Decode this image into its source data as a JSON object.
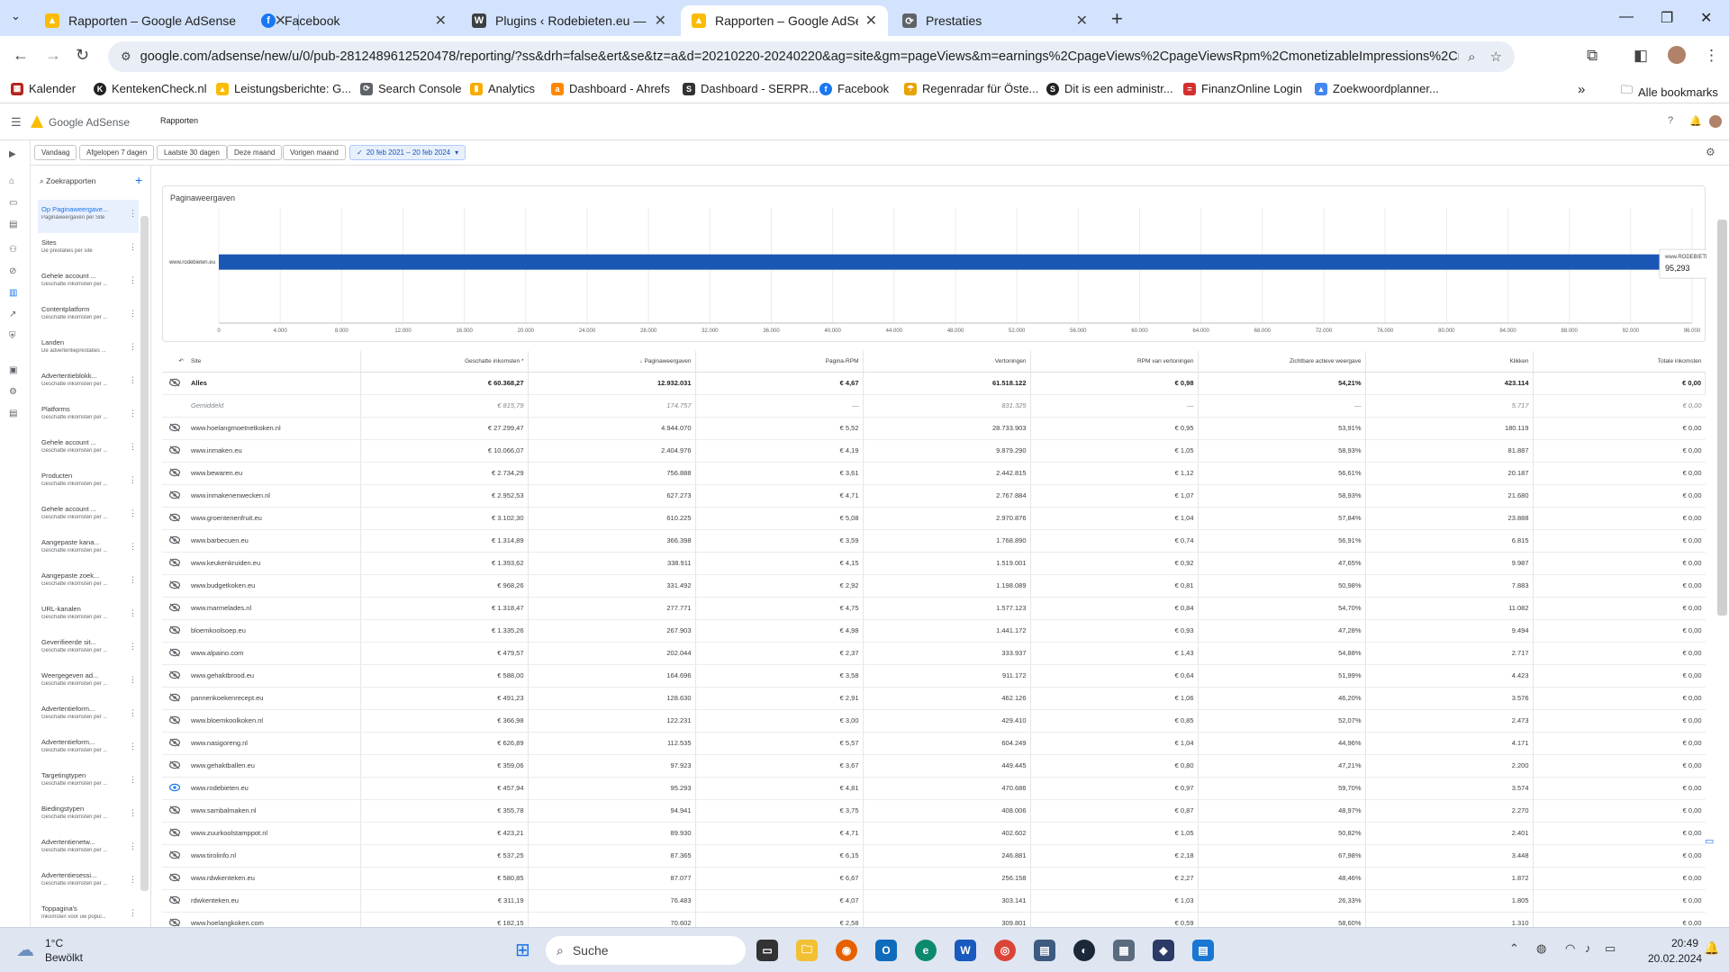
{
  "browser": {
    "tabs": [
      {
        "title": "Rapporten – Google AdSense",
        "icon": "adsense-icon",
        "active": false
      },
      {
        "title": "Facebook",
        "icon": "facebook-icon",
        "active": false
      },
      {
        "title": "Plugins ‹ Rodebieten.eu — Wor",
        "icon": "wordpress-icon",
        "active": false
      },
      {
        "title": "Rapporten – Google AdSense",
        "icon": "adsense-icon",
        "active": true
      },
      {
        "title": "Prestaties",
        "icon": "search-console-icon",
        "active": false
      }
    ],
    "url": "google.com/adsense/new/u/0/pub-2812489612520478/reporting/?ss&drh=false&ert&se&tz=a&d=20210220-20240220&ag=site&gm=pageViews&m=earnings%2CpageViews%2CpageViewsRpm%2CmonetizableImpressions%2Cmonetizabl...",
    "bookmarks": [
      "Kalender",
      "KentekenCheck.nl",
      "Leistungsberichte: G...",
      "Search Console",
      "Analytics",
      "Dashboard - Ahrefs",
      "Dashboard - SERPR...",
      "Facebook",
      "Regenradar für Öste...",
      "Dit is een administr...",
      "FinanzOnline Login",
      "Zoekwoordplanner..."
    ],
    "all_bookmarks": "Alle bookmarks"
  },
  "app": {
    "name": "Google AdSense",
    "section": "Rapporten"
  },
  "filters": [
    "Vandaag",
    "Afgelopen 7 dagen",
    "Laatste 30 dagen",
    "Deze maand",
    "Vorigen maand",
    "20 feb 2021 – 20 feb 2024"
  ],
  "reports": {
    "search_label": "Zoekrapporten",
    "items": [
      {
        "title": "Op Paginaweergave...",
        "subtitle": "Paginaweergaven per Site",
        "active": true
      },
      {
        "title": "Sites",
        "subtitle": "De prestaties per site"
      },
      {
        "title": "Gehele account ...",
        "subtitle": "Geschatte inkomsten per ..."
      },
      {
        "title": "Contentplatform",
        "subtitle": "Geschatte inkomsten per ..."
      },
      {
        "title": "Landen",
        "subtitle": "De advertentieprestaties ..."
      },
      {
        "title": "Advertentieblokk...",
        "subtitle": "Geschatte inkomsten per ..."
      },
      {
        "title": "Platforms",
        "subtitle": "Geschatte inkomsten per ..."
      },
      {
        "title": "Gehele account ...",
        "subtitle": "Geschatte inkomsten per ..."
      },
      {
        "title": "Producten",
        "subtitle": "Geschatte inkomsten per ..."
      },
      {
        "title": "Gehele account ...",
        "subtitle": "Geschatte inkomsten per ..."
      },
      {
        "title": "Aangepaste kana...",
        "subtitle": "Geschatte inkomsten per ..."
      },
      {
        "title": "Aangepaste zoek...",
        "subtitle": "Geschatte inkomsten per ..."
      },
      {
        "title": "URL-kanalen",
        "subtitle": "Geschatte inkomsten per ..."
      },
      {
        "title": "Geverifieerde sit...",
        "subtitle": "Geschatte inkomsten per ..."
      },
      {
        "title": "Weergegeven ad...",
        "subtitle": "Geschatte inkomsten per ..."
      },
      {
        "title": "Advertentieform...",
        "subtitle": "Geschatte inkomsten per ..."
      },
      {
        "title": "Advertentieform...",
        "subtitle": "Geschatte inkomsten per ..."
      },
      {
        "title": "Targetingtypen",
        "subtitle": "Geschatte inkomsten per ..."
      },
      {
        "title": "Biedingstypen",
        "subtitle": "Geschatte inkomsten per ..."
      },
      {
        "title": "Advertentienetw...",
        "subtitle": "Geschatte inkomsten per ..."
      },
      {
        "title": "Advertentiesessi...",
        "subtitle": "Geschatte inkomsten per ..."
      },
      {
        "title": "Toppagina's",
        "subtitle": "Inkomsten voor uw popul..."
      }
    ]
  },
  "chart_data": {
    "type": "bar",
    "title": "Paginaweergaven",
    "categories": [
      "www.rodebieten.eu"
    ],
    "values": [
      95293
    ],
    "xlim": [
      0,
      96000
    ],
    "xticks": [
      "0",
      "4.000",
      "8.000",
      "12.000",
      "16.000",
      "20.000",
      "24.000",
      "28.000",
      "32.000",
      "36.000",
      "40.000",
      "44.000",
      "48.000",
      "52.000",
      "56.000",
      "60.000",
      "64.000",
      "68.000",
      "72.000",
      "76.000",
      "80.000",
      "84.000",
      "88.000",
      "92.000",
      "96.000"
    ],
    "tooltip": {
      "label": "www.RODEBIETEN.eu",
      "value": "95,293"
    },
    "bar_color": "#1a56b4"
  },
  "table": {
    "columns": [
      "Site",
      "Geschatte inkomsten",
      "Paginaweergaven",
      "Pagina-RPM",
      "Vertoningen",
      "RPM van vertoningen",
      "Zichtbare actieve weergave",
      "Klikken",
      "Totale inkomsten"
    ],
    "rows": [
      {
        "site": "Alles",
        "cells": [
          "€ 60.368,27",
          "12.932.031",
          "€ 4,67",
          "61.518.122",
          "€ 0,98",
          "54,21%",
          "423.114",
          "€ 0,00"
        ],
        "bold": true
      },
      {
        "site": "Gemiddeld",
        "cells": [
          "€ 815,79",
          "174.757",
          "—",
          "831.325",
          "—",
          "—",
          "5.717",
          "€ 0,00"
        ],
        "avg": true
      },
      {
        "site": "www.hoelangmoetnetkoken.nl",
        "cells": [
          "€ 27.299,47",
          "4.944.070",
          "€ 5,52",
          "28.733.903",
          "€ 0,95",
          "53,91%",
          "180.119",
          "€ 0,00"
        ]
      },
      {
        "site": "www.inmaken.eu",
        "cells": [
          "€ 10.066,07",
          "2.404.976",
          "€ 4,19",
          "9.879.290",
          "€ 1,05",
          "58,93%",
          "81.887",
          "€ 0,00"
        ]
      },
      {
        "site": "www.bewaren.eu",
        "cells": [
          "€ 2.734,29",
          "756.888",
          "€ 3,61",
          "2.442.815",
          "€ 1,12",
          "56,61%",
          "20.187",
          "€ 0,00"
        ]
      },
      {
        "site": "www.inmakenenwecken.nl",
        "cells": [
          "€ 2.952,53",
          "627.273",
          "€ 4,71",
          "2.767.884",
          "€ 1,07",
          "58,93%",
          "21.680",
          "€ 0,00"
        ]
      },
      {
        "site": "www.groentenenfruit.eu",
        "cells": [
          "€ 3.102,30",
          "610.225",
          "€ 5,08",
          "2.970.876",
          "€ 1,04",
          "57,84%",
          "23.888",
          "€ 0,00"
        ]
      },
      {
        "site": "www.barbecuen.eu",
        "cells": [
          "€ 1.314,89",
          "366.398",
          "€ 3,59",
          "1.768.890",
          "€ 0,74",
          "56,91%",
          "6.815",
          "€ 0,00"
        ]
      },
      {
        "site": "www.keukenkruiden.eu",
        "cells": [
          "€ 1.393,62",
          "338.911",
          "€ 4,15",
          "1.519.001",
          "€ 0,92",
          "47,65%",
          "9.987",
          "€ 0,00"
        ]
      },
      {
        "site": "www.budgetkoken.eu",
        "cells": [
          "€ 968,26",
          "331.492",
          "€ 2,92",
          "1.198.089",
          "€ 0,81",
          "50,98%",
          "7.883",
          "€ 0,00"
        ]
      },
      {
        "site": "www.marmelades.nl",
        "cells": [
          "€ 1.318,47",
          "277.771",
          "€ 4,75",
          "1.577.123",
          "€ 0,84",
          "54,70%",
          "11.082",
          "€ 0,00"
        ]
      },
      {
        "site": "bloemkoolsoep.eu",
        "cells": [
          "€ 1.335,26",
          "267.903",
          "€ 4,98",
          "1.441.172",
          "€ 0,93",
          "47,28%",
          "9.494",
          "€ 0,00"
        ]
      },
      {
        "site": "www.alpaino.com",
        "cells": [
          "€ 479,57",
          "202.044",
          "€ 2,37",
          "333.937",
          "€ 1,43",
          "54,88%",
          "2.717",
          "€ 0,00"
        ]
      },
      {
        "site": "www.gehaktbrood.eu",
        "cells": [
          "€ 588,00",
          "164.696",
          "€ 3,58",
          "911.172",
          "€ 0,64",
          "51,99%",
          "4.423",
          "€ 0,00"
        ]
      },
      {
        "site": "pannenkoekenrecept.eu",
        "cells": [
          "€ 491,23",
          "128.630",
          "€ 2,91",
          "462.126",
          "€ 1,06",
          "46,20%",
          "3.576",
          "€ 0,00"
        ]
      },
      {
        "site": "www.bloemkoolkoken.nl",
        "cells": [
          "€ 366,98",
          "122.231",
          "€ 3,00",
          "429.410",
          "€ 0,85",
          "52,07%",
          "2.473",
          "€ 0,00"
        ]
      },
      {
        "site": "www.nasigoreng.nl",
        "cells": [
          "€ 626,89",
          "112.535",
          "€ 5,57",
          "604.249",
          "€ 1,04",
          "44,96%",
          "4.171",
          "€ 0,00"
        ]
      },
      {
        "site": "www.gehaktballen.eu",
        "cells": [
          "€ 359,06",
          "97.923",
          "€ 3,67",
          "449.445",
          "€ 0,80",
          "47,21%",
          "2.200",
          "€ 0,00"
        ]
      },
      {
        "site": "www.rodebieten.eu",
        "cells": [
          "€ 457,94",
          "95.293",
          "€ 4,81",
          "470.686",
          "€ 0,97",
          "59,70%",
          "3.574",
          "€ 0,00"
        ],
        "visible": true
      },
      {
        "site": "www.sambalmaken.nl",
        "cells": [
          "€ 355,78",
          "94.941",
          "€ 3,75",
          "408.006",
          "€ 0,87",
          "48,97%",
          "2.270",
          "€ 0,00"
        ]
      },
      {
        "site": "www.zuurkoolstamppot.nl",
        "cells": [
          "€ 423,21",
          "89.930",
          "€ 4,71",
          "402.602",
          "€ 1,05",
          "50,82%",
          "2.401",
          "€ 0,00"
        ]
      },
      {
        "site": "www.tirolinfo.nl",
        "cells": [
          "€ 537,25",
          "87.365",
          "€ 6,15",
          "246.881",
          "€ 2,18",
          "67,98%",
          "3.448",
          "€ 0,00"
        ]
      },
      {
        "site": "www.rdwkenteken.eu",
        "cells": [
          "€ 580,85",
          "87.077",
          "€ 6,67",
          "256.158",
          "€ 2,27",
          "48,46%",
          "1.872",
          "€ 0,00"
        ]
      },
      {
        "site": "rdwkenteken.eu",
        "cells": [
          "€ 311,19",
          "76.483",
          "€ 4,07",
          "303.141",
          "€ 1,03",
          "26,33%",
          "1.805",
          "€ 0,00"
        ]
      },
      {
        "site": "www.hoelangkoken.com",
        "cells": [
          "€ 182,15",
          "70.602",
          "€ 2,58",
          "309.801",
          "€ 0,59",
          "58,60%",
          "1.310",
          "€ 0,00"
        ]
      }
    ]
  },
  "taskbar": {
    "weather_temp": "1°C",
    "weather_desc": "Bewölkt",
    "search_label": "Suche",
    "time": "20:49",
    "date": "20.02.2024"
  }
}
